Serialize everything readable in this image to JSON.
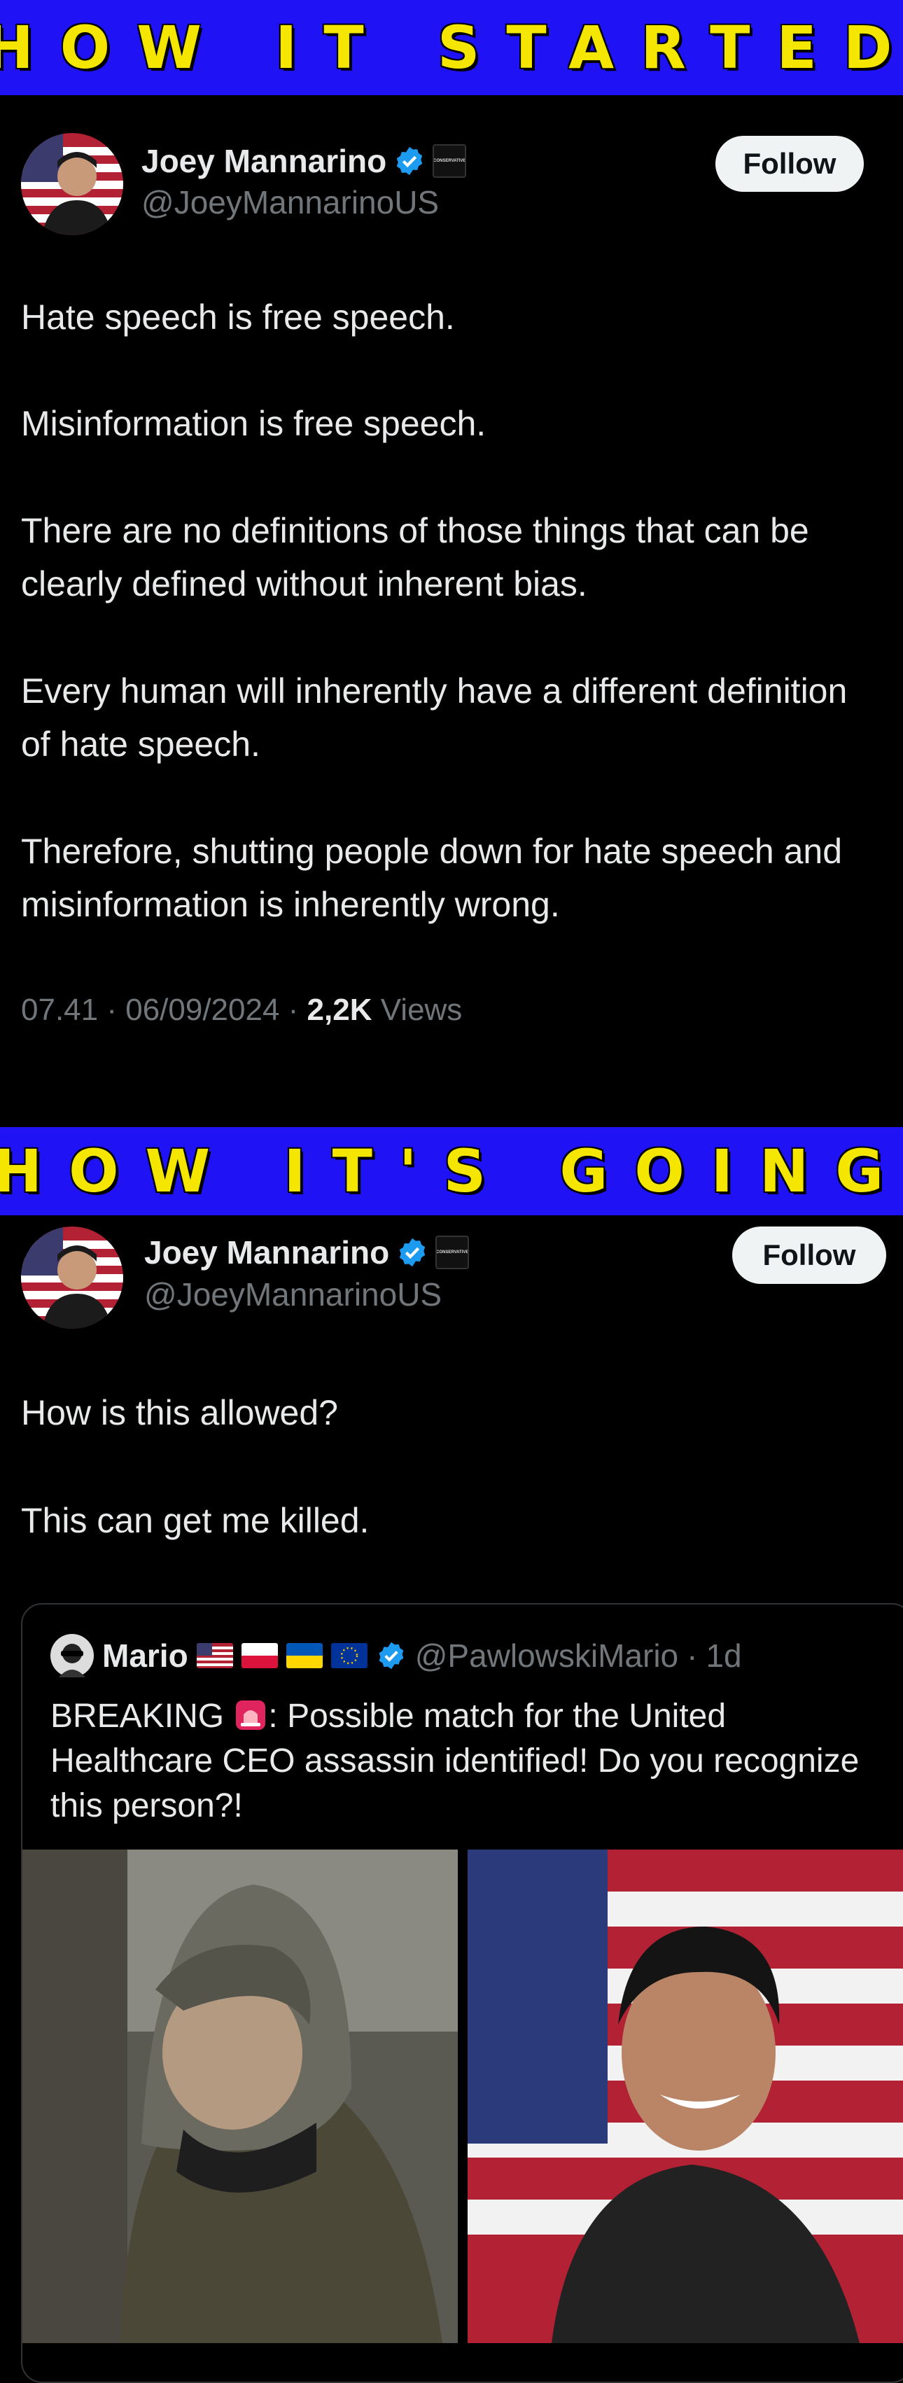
{
  "banner_top": "HOW IT STARTED",
  "banner_bottom": "HOW IT'S GOING",
  "post1": {
    "name": "Joey Mannarino",
    "handle": "@JoeyMannarinoUS",
    "follow_label": "Follow",
    "affiliation_label": "CONSERVATIVE",
    "paragraphs": [
      "Hate speech is free speech.",
      "Misinformation is free speech.",
      "There are no definitions of those things that can be clearly defined without inherent bias.",
      "Every human will inherently have a different definition of hate speech.",
      "Therefore, shutting people down for hate speech and misinformation is inherently wrong."
    ],
    "time": "07.41",
    "date": "06/09/2024",
    "views_count": "2,2K",
    "views_label": "Views"
  },
  "post2": {
    "name": "Joey Mannarino",
    "handle": "@JoeyMannarinoUS",
    "follow_label": "Follow",
    "affiliation_label": "CONSERVATIVE",
    "paragraphs": [
      "How is this allowed?",
      "This can get me killed."
    ],
    "quote": {
      "name": "Mario",
      "handle": "@PawlowskiMario",
      "age": "1d",
      "text_prefix": "BREAKING",
      "text_suffix": ": Possible match for the United Healthcare CEO assassin identified! Do you recognize this person?!"
    }
  },
  "colors": {
    "banner_bg": "#1f12f5",
    "banner_text": "#f5e600",
    "verified": "#1d9bf0",
    "muted": "#71767b",
    "text": "#e7e9ea",
    "background": "#000000"
  },
  "icons": [
    "verified-badge-icon",
    "siren-icon",
    "us-flag-icon",
    "poland-flag-icon",
    "ukraine-flag-icon",
    "eu-flag-icon"
  ]
}
